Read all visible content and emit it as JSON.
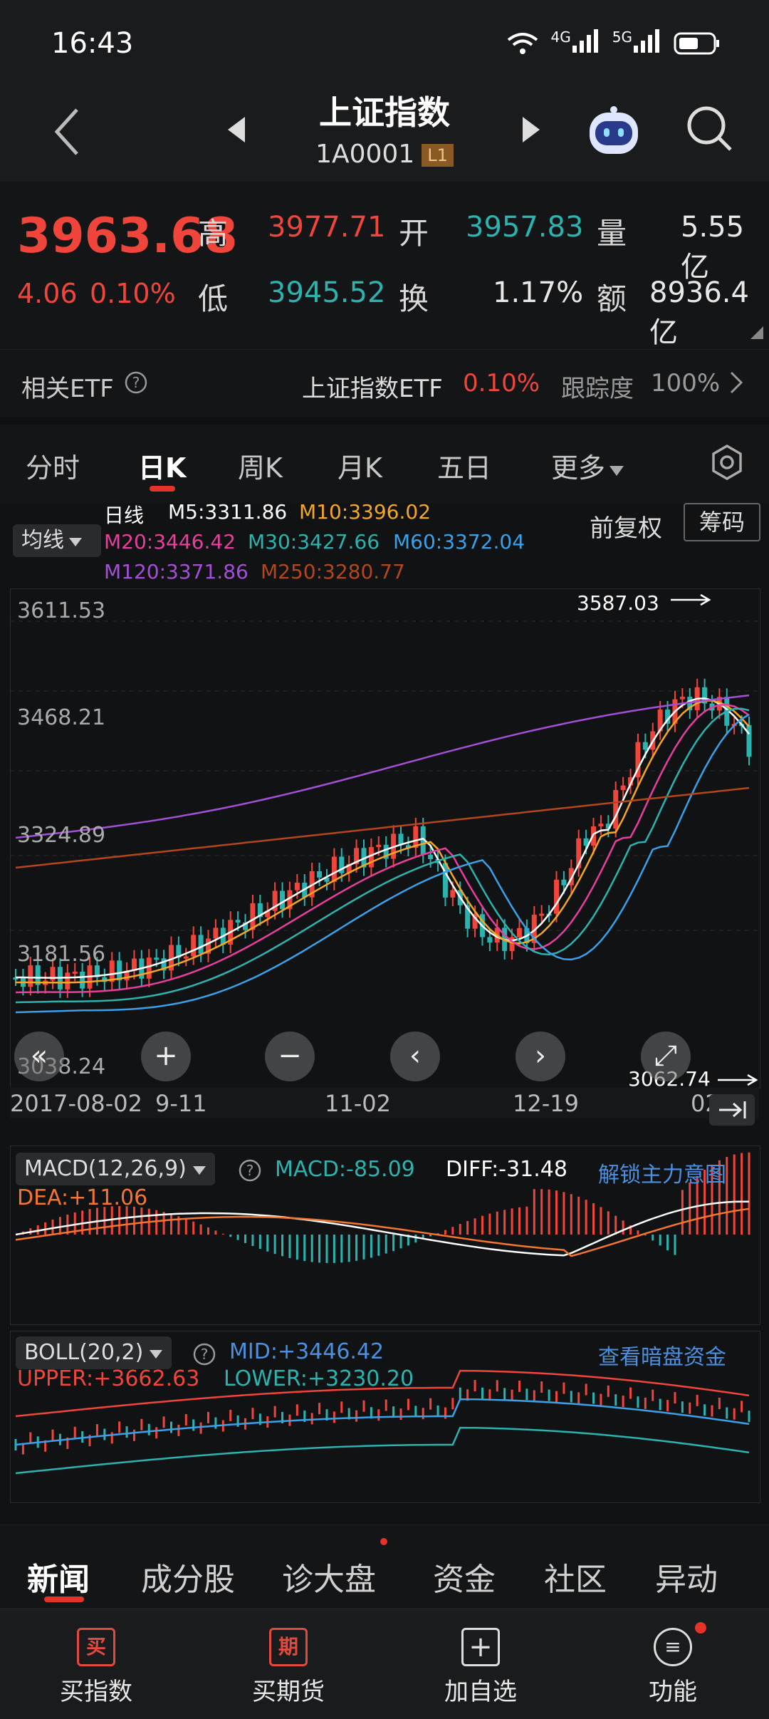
{
  "status_bar": {
    "time": "16:43",
    "signal1": "4G",
    "signal2": "5G"
  },
  "header": {
    "title": "上证指数",
    "code": "1A0001",
    "badge": "L1"
  },
  "quote": {
    "price": "3963.68",
    "change": "4.06",
    "change_pct": "0.10%",
    "high_label": "高",
    "high": "3977.71",
    "open_label": "开",
    "open": "3957.83",
    "volume_label": "量",
    "volume": "5.55亿",
    "low_label": "低",
    "low": "3945.52",
    "turnover_label": "换",
    "turnover": "1.17%",
    "amount_label": "额",
    "amount": "8936.4亿"
  },
  "etf": {
    "label": "相关ETF",
    "name": "上证指数ETF",
    "pct": "0.10%",
    "track_label": "跟踪度",
    "track": "100%"
  },
  "tabs": [
    "分时",
    "日K",
    "周K",
    "月K",
    "五日",
    "更多"
  ],
  "active_tab": "日K",
  "ma_legend": {
    "dropdown": "均线",
    "period": "日线",
    "m5": "M5:3311.86",
    "m10": "M10:3396.02",
    "m20": "M20:3446.42",
    "m30": "M30:3427.66",
    "m60": "M60:3372.04",
    "m120": "M120:3371.86",
    "m250": "M250:3280.77",
    "adjust": "前复权",
    "chips": "筹码"
  },
  "colors": {
    "up": "#f0453b",
    "down": "#2bb3b0",
    "m5": "#ffffff",
    "m10": "#f5a623",
    "m20": "#e83e9c",
    "m30": "#2bb3b0",
    "m60": "#3aa0e8",
    "m120": "#a44fd6",
    "m250": "#b5451b"
  },
  "kline": {
    "y_ticks": [
      "3611.53",
      "3468.21",
      "3324.89",
      "3181.56",
      "3038.24"
    ],
    "max_label": "3587.03",
    "min_label": "3062.74",
    "x_ticks": [
      "2017-08-02",
      "9-11",
      "11-02",
      "12-19",
      "02"
    ]
  },
  "macd": {
    "dropdown": "MACD(12,26,9)",
    "macd": "MACD:-85.09",
    "diff": "DIFF:-31.48",
    "dea": "DEA:+11.06",
    "unlock": "解锁主力意图"
  },
  "boll": {
    "dropdown": "BOLL(20,2)",
    "mid": "MID:+3446.42",
    "upper": "UPPER:+3662.63",
    "lower": "LOWER:+3230.20",
    "dark": "查看暗盘资金"
  },
  "news_tabs": [
    "新闻",
    "成分股",
    "诊大盘",
    "资金",
    "社区",
    "异动"
  ],
  "bottom_nav": [
    {
      "icon": "买",
      "label": "买指数"
    },
    {
      "icon": "期",
      "label": "买期货"
    },
    {
      "icon": "+",
      "label": "加自选"
    },
    {
      "icon": "≡",
      "label": "功能"
    }
  ]
}
